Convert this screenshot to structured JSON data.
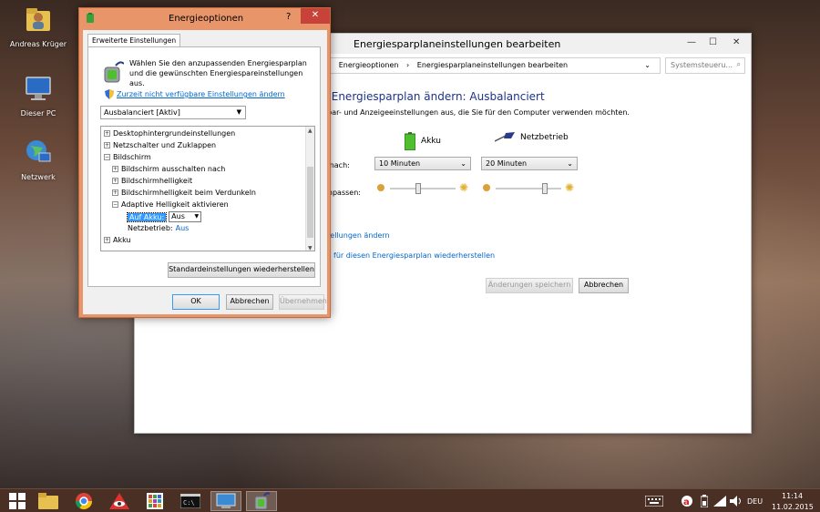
{
  "desktop": {
    "icons": [
      {
        "label": "Andreas Krüger",
        "icon": "user-folder-icon"
      },
      {
        "label": "Dieser PC",
        "icon": "computer-icon"
      },
      {
        "label": "Netzwerk",
        "icon": "network-globe-icon"
      }
    ]
  },
  "plan_window": {
    "title": "Energiesparplaneinstellungen bearbeiten",
    "breadcrumb": [
      "Energieoptionen",
      "Energiesparplaneinstellungen bearbeiten"
    ],
    "search_placeholder": "Systemsteueru...",
    "heading": "r Energiesparplan ändern: Ausbalanciert",
    "subtitle": "spar- und Anzeigeeinstellungen aus, die Sie für den Computer verwenden möchten.",
    "col_battery": "Akku",
    "col_plugged": "Netzbetrieb",
    "row_display_off_label": "s nach:",
    "display_off_battery": "10 Minuten",
    "display_off_plugged": "20 Minuten",
    "row_brightness_label": "anpassen:",
    "brightness_battery": 0.42,
    "brightness_plugged": 0.78,
    "link_advanced": "stellungen ändern",
    "link_restore": "für diesen Energiesparplan wiederherstellen",
    "save_button": "Änderungen speichern",
    "cancel_button": "Abbrechen"
  },
  "dialog": {
    "title": "Energieoptionen",
    "help": "?",
    "close": "✕",
    "tab": "Erweiterte Einstellungen",
    "info_text": "Wählen Sie den anzupassenden Energiesparplan und die gewünschten Energiespareinstellungen aus.",
    "uac_link": "Zurzeit nicht verfügbare Einstellungen ändern",
    "plan_select": "Ausbalanciert [Aktiv]",
    "tree": [
      {
        "label": "Desktophintergrundeinstellungen",
        "expander": "+"
      },
      {
        "label": "Netzschalter und Zuklappen",
        "expander": "+"
      },
      {
        "label": "Bildschirm",
        "expander": "−"
      },
      {
        "label": "Bildschirm ausschalten nach",
        "expander": "+"
      },
      {
        "label": "Bildschirmhelligkeit",
        "expander": "+"
      },
      {
        "label": "Bildschirmhelligkeit beim Verdunkeln",
        "expander": "+"
      },
      {
        "label": "Adaptive Helligkeit aktivieren",
        "expander": "−"
      },
      {
        "label": "Akku",
        "expander": "+"
      }
    ],
    "on_battery_label": "Auf Akku:",
    "on_battery_value": "Aus",
    "plugged_label": "Netzbetrieb:",
    "plugged_value": "Aus",
    "restore_defaults": "Standardeinstellungen wiederherstellen",
    "ok": "OK",
    "cancel": "Abbrechen",
    "apply": "Übernehmen"
  },
  "taskbar": {
    "lang": "DEU",
    "time": "11:14",
    "date": "11.02.2015"
  },
  "colors": {
    "dialog_frame": "#e8956a",
    "close_red": "#c7433a",
    "link_blue": "#0066cc",
    "heading_blue": "#1e3287",
    "selection_blue": "#3399ff"
  }
}
